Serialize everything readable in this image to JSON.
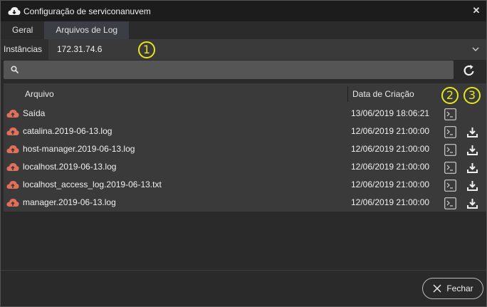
{
  "window": {
    "title": "Configuração de serviconanuvem",
    "close_icon": "close-icon"
  },
  "tabs": [
    {
      "label": "Geral",
      "active": false
    },
    {
      "label": "Arquivos de Log",
      "active": true
    }
  ],
  "instances": {
    "label": "Instâncias",
    "selected": "172.31.74.6"
  },
  "search": {
    "value": "",
    "placeholder": ""
  },
  "table": {
    "columns": [
      "Arquivo",
      "Data de Criação"
    ],
    "rows": [
      {
        "name": "Saída",
        "date": "13/06/2019 18:06:21",
        "download": false
      },
      {
        "name": "catalina.2019-06-13.log",
        "date": "12/06/2019 21:00:00",
        "download": true
      },
      {
        "name": "host-manager.2019-06-13.log",
        "date": "12/06/2019 21:00:00",
        "download": true
      },
      {
        "name": "localhost.2019-06-13.log",
        "date": "12/06/2019 21:00:00",
        "download": true
      },
      {
        "name": "localhost_access_log.2019-06-13.txt",
        "date": "12/06/2019 21:00:00",
        "download": true
      },
      {
        "name": "manager.2019-06-13.log",
        "date": "12/06/2019 21:00:00",
        "download": true
      }
    ]
  },
  "annotations": [
    "1",
    "2",
    "3"
  ],
  "footer": {
    "close_label": "Fechar"
  },
  "colors": {
    "accent_marker": "#e6e61a",
    "cloud_icon": "#e0705a",
    "active_tab": "#3b3e44"
  }
}
